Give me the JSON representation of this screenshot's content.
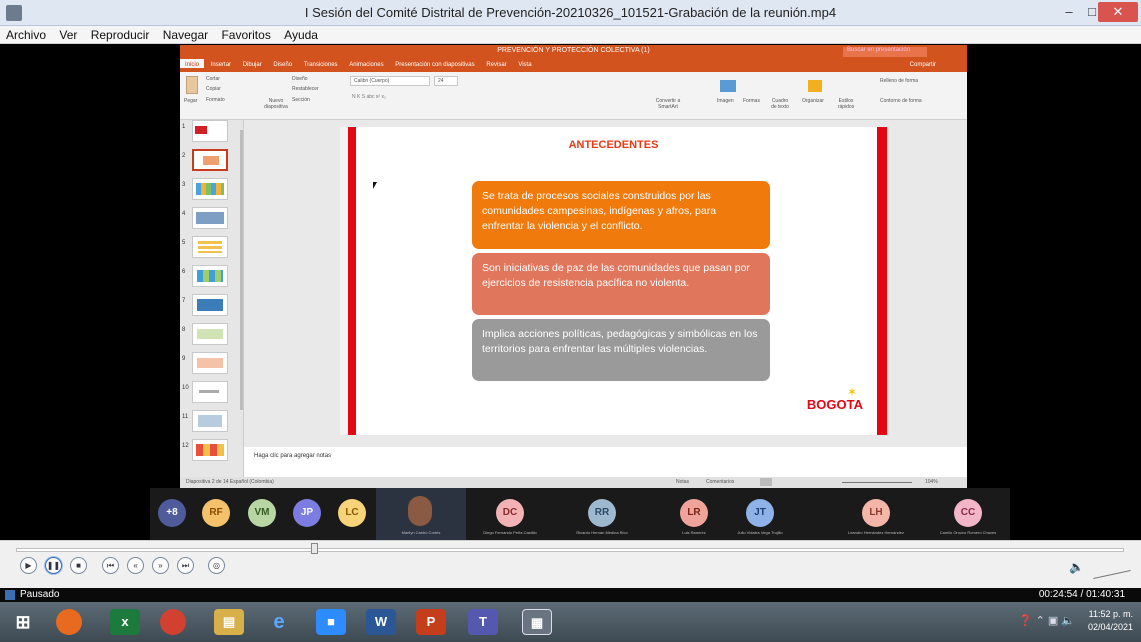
{
  "window": {
    "title": "I Sesión del Comité Distrital de Prevención-20210326_101521-Grabación de la reunión.mp4",
    "min_label": "–",
    "max_label": "□",
    "close_label": "✕"
  },
  "menubar": [
    "Archivo",
    "Ver",
    "Reproducir",
    "Navegar",
    "Favoritos",
    "Ayuda"
  ],
  "ppt": {
    "title": "PREVENCIÓN Y PROTECCIÓN COLECTIVA (1)",
    "search_placeholder": "Buscar en presentación",
    "share_label": "Compartir",
    "tabs": [
      "Inicio",
      "Insertar",
      "Dibujar",
      "Diseño",
      "Transiciones",
      "Animaciones",
      "Presentación con diapositivas",
      "Revisar",
      "Vista"
    ],
    "ribbon": {
      "paste": "Pegar",
      "cut": "Cortar",
      "copy": "Copiar",
      "format": "Formato",
      "new_slide": "Nuevo diapositiva",
      "layout": "Diseño",
      "reset": "Restablecer",
      "section": "Sección",
      "font": "Calibri (Cuerpo)",
      "size": "24",
      "convert": "Convertir a SmartArt",
      "image": "Imagen",
      "shapes": "Formas",
      "textbox": "Cuadro de texto",
      "organize": "Organizar",
      "quick_styles": "Estilos rápidos",
      "fill": "Relleno de forma",
      "outline": "Contorno de forma"
    },
    "thumb_numbers": [
      "1",
      "2",
      "3",
      "4",
      "5",
      "6",
      "7",
      "8",
      "9",
      "10",
      "11",
      "12"
    ],
    "slide": {
      "heading": "ANTECEDENTES",
      "box1": "Se trata de procesos sociales construidos por las comunidades campesinas, indígenas y afros, para enfrentar la violencia y el conflicto.",
      "box2": "Son iniciativas de paz de las comunidades que pasan por ejercicios de resistencia pacífica no violenta.",
      "box3": "Implica acciones políticas, pedagógicas y simbólicas en los territorios para enfrentar las múltiples violencias.",
      "logo": "BOGOTA"
    },
    "notes_placeholder": "Haga clic para agregar notas",
    "status_left": "Diapositiva 2 de 14   Español (Colombia)",
    "status_notes": "Notas",
    "status_comments": "Comentarios",
    "zoom": "104%"
  },
  "participants": {
    "more": "+8",
    "avatars": [
      {
        "initials": "RF",
        "color": "#f5c16b",
        "text": "#8a4b00",
        "name": ""
      },
      {
        "initials": "VM",
        "color": "#b7d6a3",
        "text": "#355b22",
        "name": ""
      },
      {
        "initials": "JP",
        "color": "#7b7ee0",
        "text": "#ffffff",
        "name": ""
      },
      {
        "initials": "LC",
        "color": "#f7d479",
        "text": "#8a5a00",
        "name": ""
      },
      {
        "initials": "DC",
        "color": "#f3b3b5",
        "text": "#8b2a2e",
        "name": "Diego Fernando Peña Castillo"
      },
      {
        "initials": "RR",
        "color": "#9eb8cf",
        "text": "#2c4a66",
        "name": "Ricardo Hernan Medina Rico"
      },
      {
        "initials": "LR",
        "color": "#f0a39a",
        "text": "#7a2318",
        "name": "Luis Ramírez"
      },
      {
        "initials": "JT",
        "color": "#8fb3e8",
        "text": "#1f3f7a",
        "name": "Julio Vidales Vega Trujillo"
      },
      {
        "initials": "LH",
        "color": "#f4b6a8",
        "text": "#8a3a2a",
        "name": "Leandro Hernández Hernández"
      },
      {
        "initials": "CC",
        "color": "#f3b6c8",
        "text": "#8b2a4a",
        "name": "Camilo Orozco Romero Chaves"
      }
    ],
    "speaker_name": "Marilyn Castro Cortés"
  },
  "player": {
    "progress": 0.27,
    "status": "Pausado",
    "time": "00:24:54 / 01:40:31",
    "buttons": [
      "play",
      "pause",
      "stop",
      "prev",
      "rewind",
      "forward",
      "next",
      "fullscreen"
    ]
  },
  "taskbar": {
    "apps": [
      {
        "name": "start",
        "glyph": "⊞",
        "color": "#2a7fd6"
      },
      {
        "name": "firefox",
        "glyph": "●",
        "color": "#e86a1f"
      },
      {
        "name": "excel",
        "glyph": "x",
        "color": "#1d7a3d"
      },
      {
        "name": "chrome",
        "glyph": "◉",
        "color": "#d2402f"
      },
      {
        "name": "explorer",
        "glyph": "▤",
        "color": "#d8b04a"
      },
      {
        "name": "ie",
        "glyph": "e",
        "color": "#2a6fd0"
      },
      {
        "name": "zoom",
        "glyph": "■",
        "color": "#2d8cff"
      },
      {
        "name": "word",
        "glyph": "W",
        "color": "#2b5797"
      },
      {
        "name": "powerpoint",
        "glyph": "P",
        "color": "#c43e1c"
      },
      {
        "name": "teams",
        "glyph": "T",
        "color": "#5558af"
      },
      {
        "name": "mediaplayer",
        "glyph": "▦",
        "color": "#6a7480"
      }
    ],
    "time": "11:52 p. m.",
    "date": "02/04/2021"
  }
}
